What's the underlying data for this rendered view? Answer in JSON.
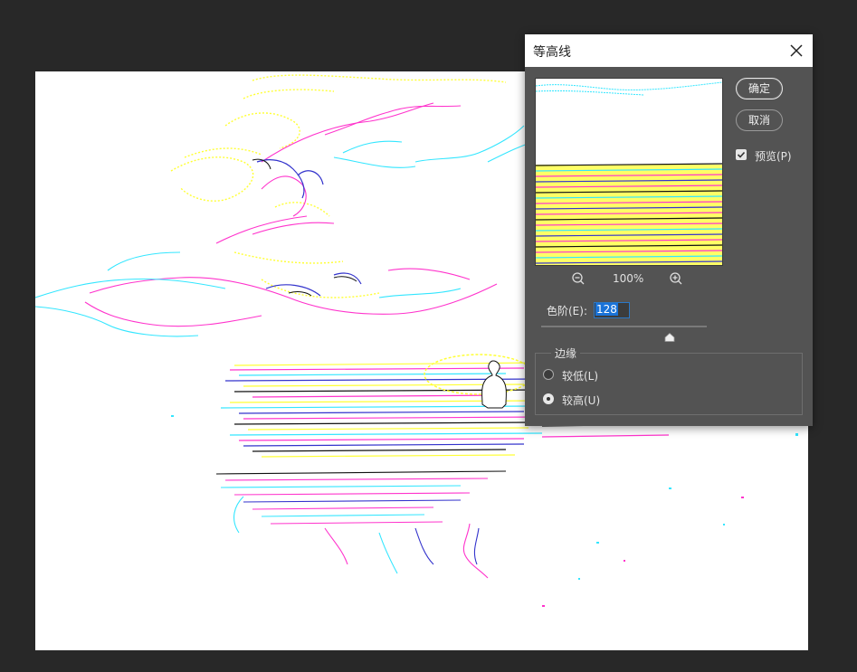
{
  "dialog": {
    "title": "等高线",
    "ok_label": "确定",
    "cancel_label": "取消",
    "preview_label": "预览(P)",
    "preview_checked": true,
    "zoom_level": "100%",
    "level_label": "色阶(E):",
    "level_value": "128",
    "level_max": 255,
    "edge_title": "边缘",
    "edge_options": [
      "较低(L)",
      "较高(U)"
    ],
    "edge_selected": "较高(U)"
  },
  "colors": {
    "workspace_bg": "#282828",
    "dialog_bg": "#535353",
    "contour_colors": [
      "#ffff33",
      "#ff33cc",
      "#33e6ff",
      "#3333cc",
      "#111111"
    ]
  },
  "icons": {
    "close": "close-icon",
    "zoom_out": "zoom-out-icon",
    "zoom_in": "zoom-in-icon",
    "check": "checkmark-icon",
    "thumb": "slider-thumb-icon"
  }
}
